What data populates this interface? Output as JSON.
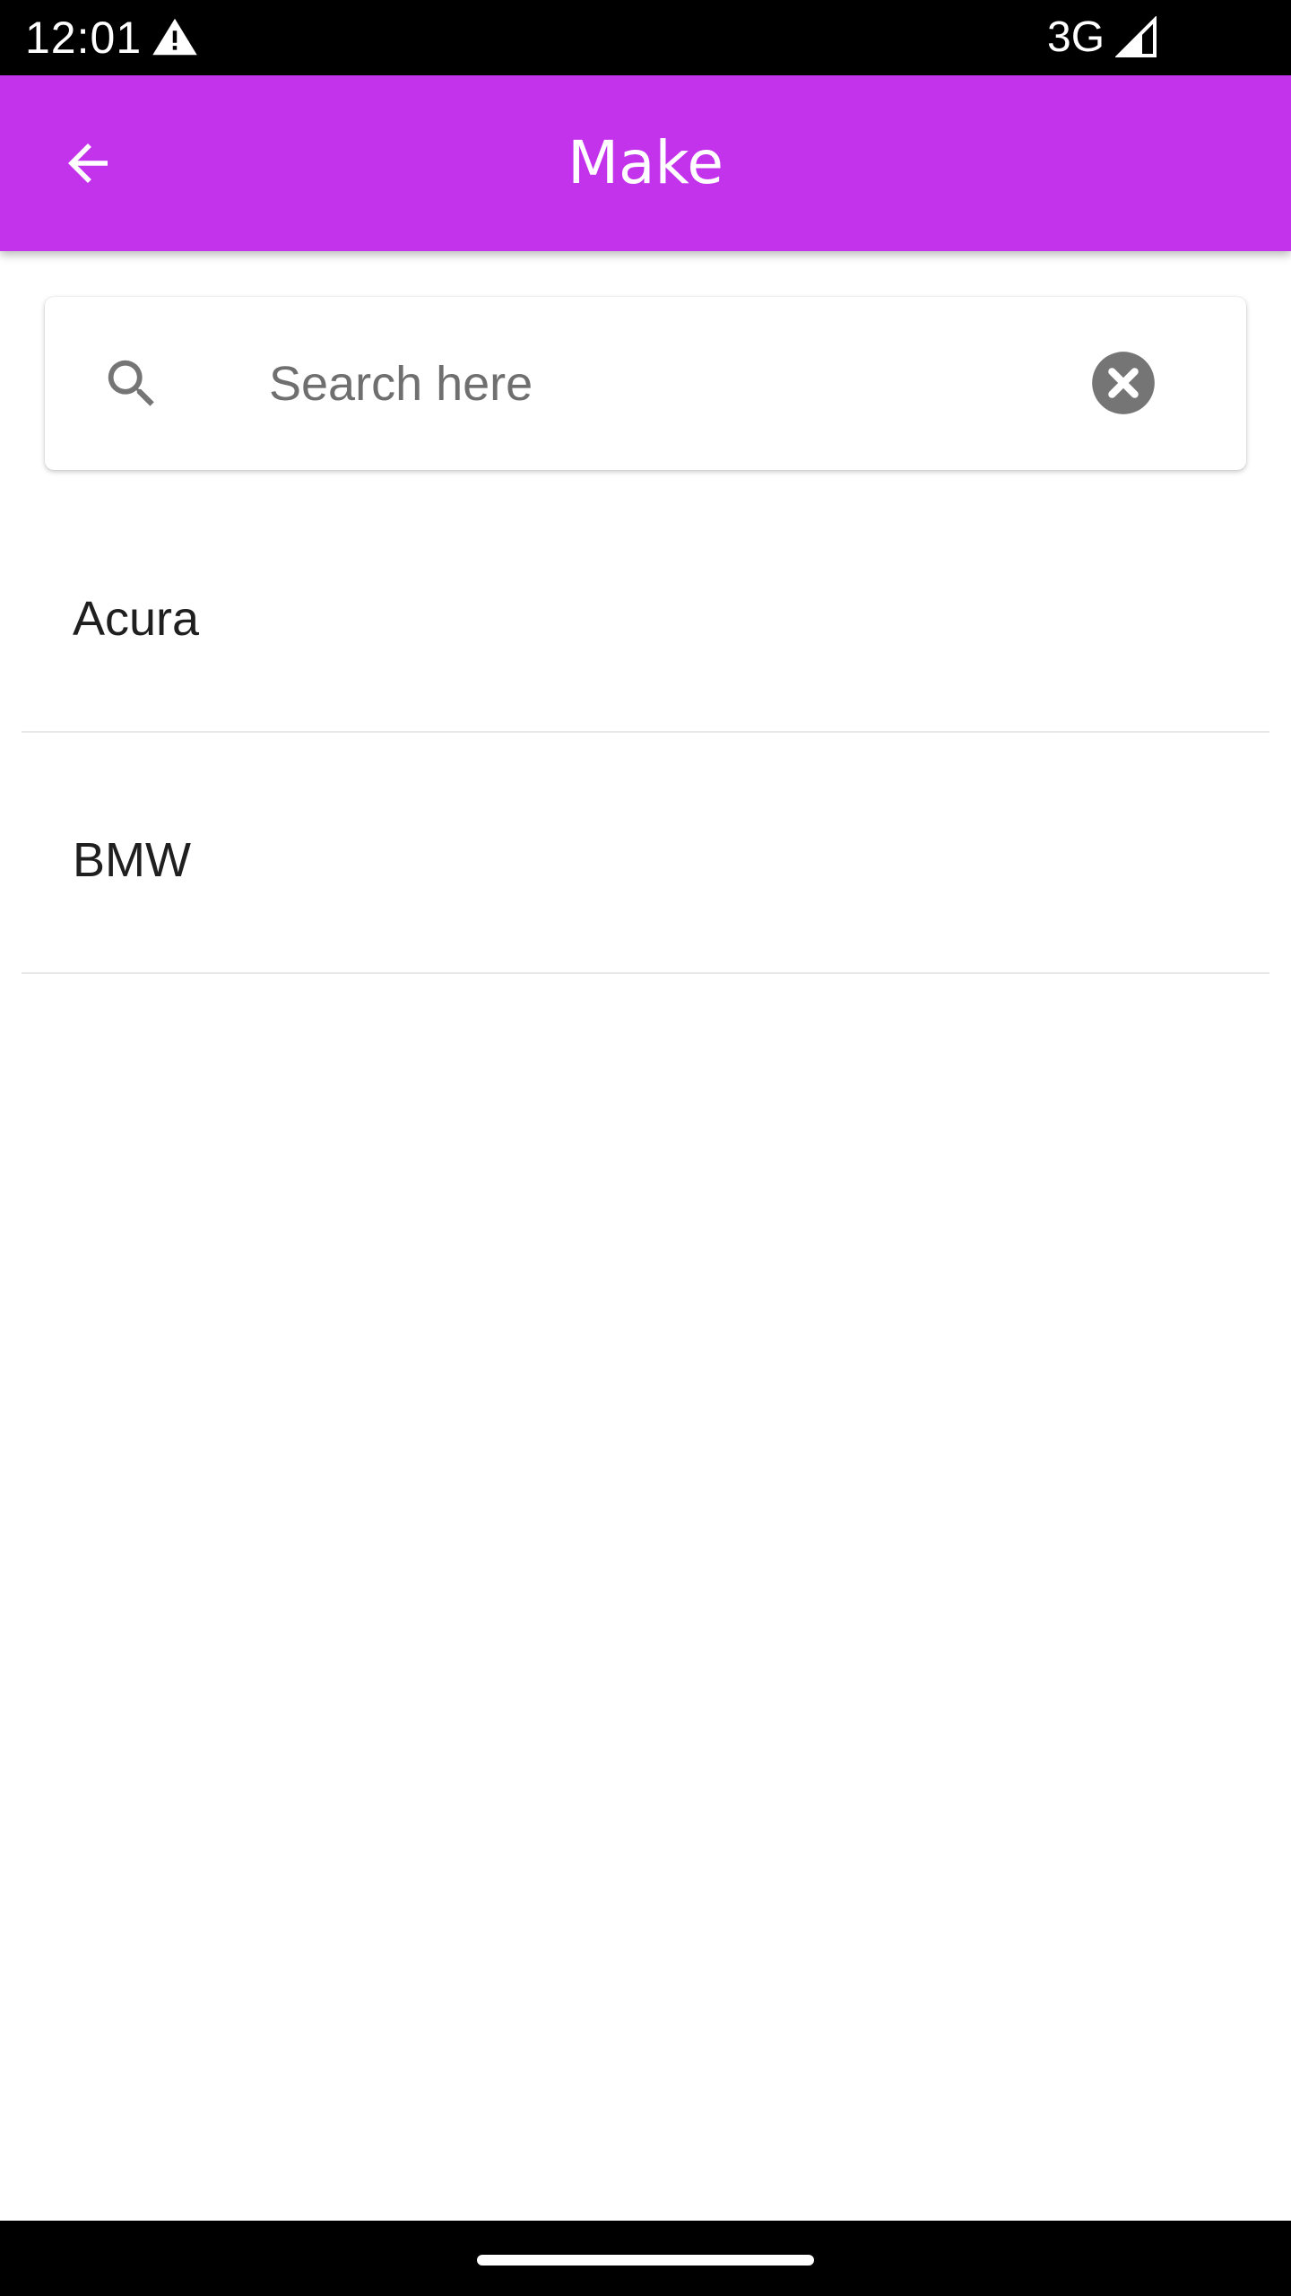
{
  "status_bar": {
    "time": "12:01",
    "network": "3G",
    "icons": [
      "warning-icon",
      "signal-icon"
    ]
  },
  "app_bar": {
    "title": "Make",
    "back_icon": "arrow-back-icon",
    "color": "#c433ec"
  },
  "search": {
    "placeholder": "Search here",
    "value": "",
    "search_icon": "search-icon",
    "clear_icon": "clear-circle-icon"
  },
  "makes": [
    {
      "label": "Acura"
    },
    {
      "label": "BMW"
    }
  ]
}
